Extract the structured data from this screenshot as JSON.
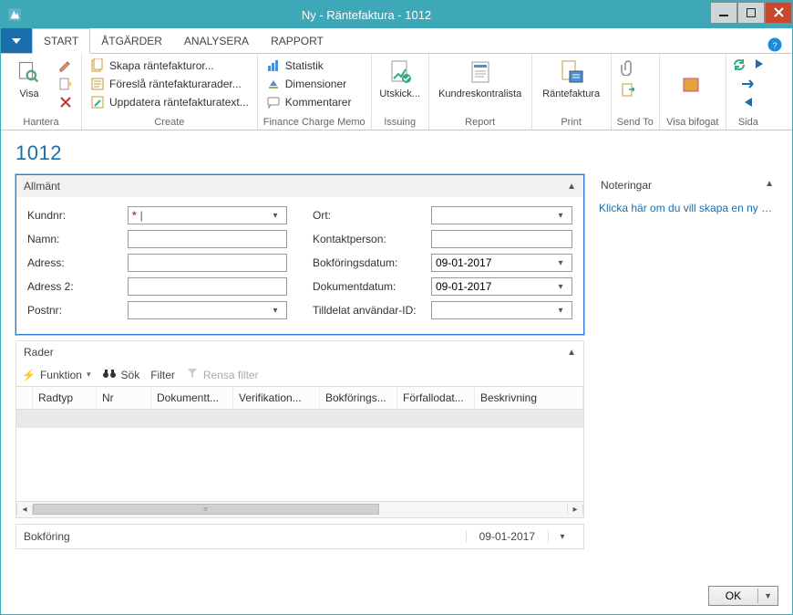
{
  "window": {
    "title": "Ny - Räntefaktura - 1012"
  },
  "ribbon": {
    "tabs": {
      "start": "START",
      "atgarder": "ÅTGÄRDER",
      "analysera": "ANALYSERA",
      "rapport": "RAPPORT"
    },
    "hantera": {
      "label": "Hantera",
      "visa": "Visa"
    },
    "create": {
      "label": "Create",
      "skapa": "Skapa räntefakturor...",
      "foresla": "Föreslå räntefakturarader...",
      "uppdatera": "Uppdatera räntefakturatext..."
    },
    "fcm": {
      "label": "Finance Charge Memo",
      "statistik": "Statistik",
      "dimensioner": "Dimensioner",
      "kommentarer": "Kommentarer"
    },
    "issuing": {
      "label": "Issuing",
      "utskick": "Utskick..."
    },
    "report": {
      "label": "Report",
      "kundres": "Kundreskontralista"
    },
    "print": {
      "label": "Print",
      "rantefaktura": "Räntefaktura"
    },
    "sendto": {
      "label": "Send To"
    },
    "visabifogat": {
      "label": "Visa bifogat"
    },
    "sida": {
      "label": "Sida"
    }
  },
  "page": {
    "title": "1012"
  },
  "allmant": {
    "header": "Allmänt",
    "kundnr_label": "Kundnr:",
    "namn_label": "Namn:",
    "adress_label": "Adress:",
    "adress2_label": "Adress 2:",
    "postnr_label": "Postnr:",
    "ort_label": "Ort:",
    "kontakt_label": "Kontaktperson:",
    "bokforingsdatum_label": "Bokföringsdatum:",
    "bokforingsdatum_value": "09-01-2017",
    "dokumentdatum_label": "Dokumentdatum:",
    "dokumentdatum_value": "09-01-2017",
    "tilldelat_label": "Tilldelat användar-ID:"
  },
  "rader": {
    "header": "Rader",
    "funktion": "Funktion",
    "sok": "Sök",
    "filter": "Filter",
    "rensa": "Rensa filter",
    "cols": {
      "radtyp": "Radtyp",
      "nr": "Nr",
      "dokument": "Dokumentt...",
      "verifikation": "Verifikation...",
      "bokforings": "Bokförings...",
      "forfallodat": "Förfallodat...",
      "beskrivning": "Beskrivning"
    }
  },
  "bokforing": {
    "label": "Bokföring",
    "date": "09-01-2017"
  },
  "noteringar": {
    "header": "Noteringar",
    "link": "Klicka här om du vill skapa en ny an..."
  },
  "footer": {
    "ok": "OK"
  }
}
